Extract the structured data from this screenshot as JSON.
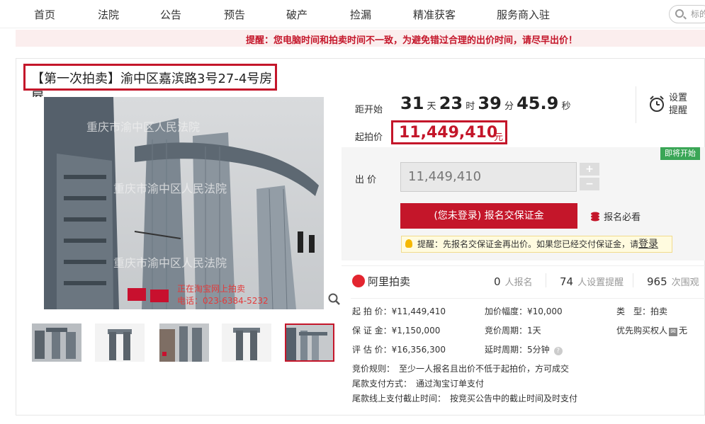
{
  "nav": {
    "items": [
      "首页",
      "法院",
      "公告",
      "预告",
      "破产",
      "捡漏",
      "精准获客",
      "服务商入驻"
    ],
    "search_placeholder": "标的"
  },
  "warning": "提醒：您电脑时间和拍卖时间不一致，为避免错过合理的出价时间，请尽早出价！",
  "title": "【第一次拍卖】渝中区嘉滨路3号27-4号房屋",
  "image": {
    "watermark_lines": [
      "重庆市渝中区人民法院",
      "重庆市渝中区人民法院",
      "重庆市渝中区人民法院"
    ],
    "caption_lines": [
      "正在淘宝网上拍卖",
      "电话：023-6384-5232"
    ],
    "thumbnails_count": 5,
    "selected_thumbnail": 5
  },
  "countdown": {
    "label": "距开始",
    "days": "31",
    "days_unit": "天",
    "hours": "23",
    "hours_unit": "时",
    "minutes": "39",
    "minutes_unit": "分",
    "seconds": "45.9",
    "seconds_unit": "秒"
  },
  "alarm": {
    "line1": "设置",
    "line2": "提醒"
  },
  "start_price": {
    "label": "起拍价",
    "value": "11,449,410",
    "unit": "元"
  },
  "status_badge": "即将开始",
  "bid": {
    "label": "出 价",
    "value": "11,449,410",
    "plus": "+",
    "minus": "−",
    "signup_button": "(您未登录) 报名交保证金",
    "signup_view": "报名必看",
    "tip_prefix": "提醒：先报名交保证金再出价。如果您已经交付保证金，请",
    "tip_login": "登录"
  },
  "stats": {
    "logo": "阿里拍卖",
    "signups_count": "0",
    "signups_label": "人报名",
    "reminders_count": "74",
    "reminders_label": "人设置提醒",
    "views_count": "965",
    "views_label": "次围观"
  },
  "details": {
    "start_price": "起 拍 价：¥11,449,410",
    "deposit": "保 证 金：¥1,150,000",
    "appraisal": "评 估 价：¥16,356,300",
    "increment": "加价幅度：¥10,000",
    "cycle": "竞价周期：1天",
    "delay": "延时周期：5分钟",
    "type_label": "类　型：",
    "type_value": "拍卖",
    "priority_label": "优先购买权人",
    "priority_value": "无",
    "rule": "竞价规则：　至少一人报名且出价不低于起拍价，方可成交",
    "payment": "尾款支付方式：　通过淘宝订单支付",
    "deadline": "尾款线上支付截止时间：　按竞买公告中的截止时间及时支付"
  }
}
